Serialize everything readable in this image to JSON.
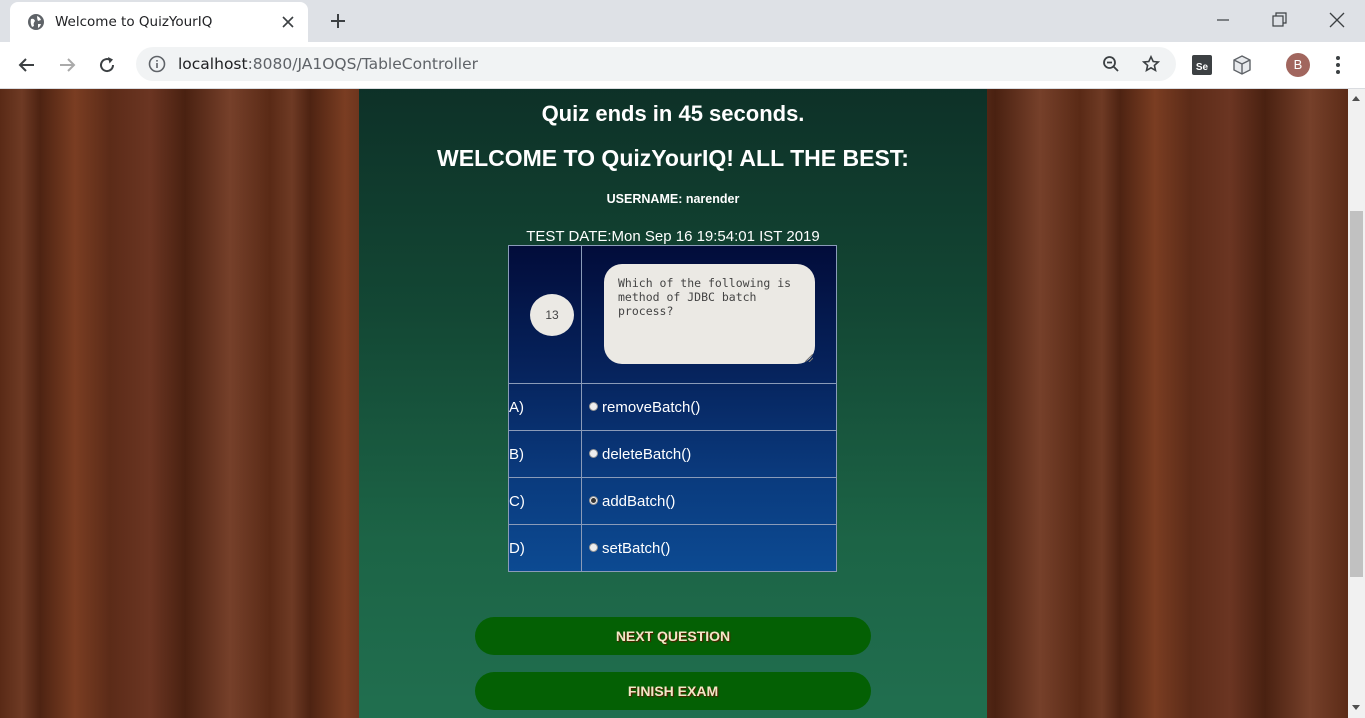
{
  "browser": {
    "tab_title": "Welcome to QuizYourIQ",
    "url_host": "localhost",
    "url_rest": ":8080/JA1OQS/TableController",
    "avatar_letter": "B"
  },
  "quiz": {
    "timer_text": "Quiz ends in 45 seconds.",
    "welcome_text": "WELCOME TO QuizYourIQ! ALL THE BEST:",
    "username_text": "USERNAME: narender",
    "test_date_text": "TEST DATE:Mon Sep 16 19:54:01 IST 2019",
    "question_number": "13",
    "question_text": "Which of the following is method of JDBC batch process?",
    "options": [
      {
        "label": "A)",
        "text": "removeBatch()",
        "selected": false
      },
      {
        "label": "B)",
        "text": "deleteBatch()",
        "selected": false
      },
      {
        "label": "C)",
        "text": "addBatch()",
        "selected": true
      },
      {
        "label": "D)",
        "text": "setBatch()",
        "selected": false
      }
    ],
    "next_button": "NEXT QUESTION",
    "finish_button": "FINISH EXAM"
  }
}
